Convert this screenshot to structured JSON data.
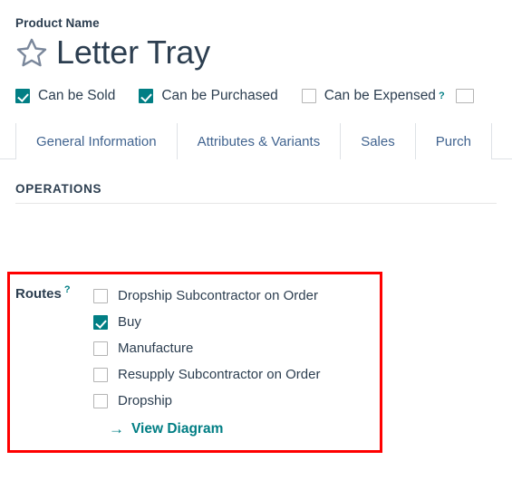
{
  "form": {
    "product_name_label": "Product Name",
    "product_name_value": "Letter Tray",
    "favorite_icon": "star-outline-icon"
  },
  "flags": [
    {
      "label": "Can be Sold",
      "checked": true,
      "help": null
    },
    {
      "label": "Can be Purchased",
      "checked": true,
      "help": null
    },
    {
      "label": "Can be Expensed",
      "checked": false,
      "help": "?"
    }
  ],
  "tabs": [
    {
      "label": "General Information",
      "active": true
    },
    {
      "label": "Attributes & Variants",
      "active": false
    },
    {
      "label": "Sales",
      "active": false
    },
    {
      "label": "Purch",
      "active": false
    }
  ],
  "operations": {
    "section_title": "OPERATIONS",
    "routes_label": "Routes",
    "routes_help": "?",
    "routes": [
      {
        "label": "Dropship Subcontractor on Order",
        "checked": false
      },
      {
        "label": "Buy",
        "checked": true
      },
      {
        "label": "Manufacture",
        "checked": false
      },
      {
        "label": "Resupply Subcontractor on Order",
        "checked": false
      },
      {
        "label": "Dropship",
        "checked": false
      }
    ],
    "view_diagram": {
      "arrow": "→",
      "label": "View Diagram",
      "icon": "arrow-right-icon"
    }
  },
  "colors": {
    "accent_teal": "#017e84",
    "text_dark": "#2c3e50",
    "tab_link": "#40638f",
    "highlight_red": "#ff0000",
    "border_gray": "#dee2e6"
  }
}
